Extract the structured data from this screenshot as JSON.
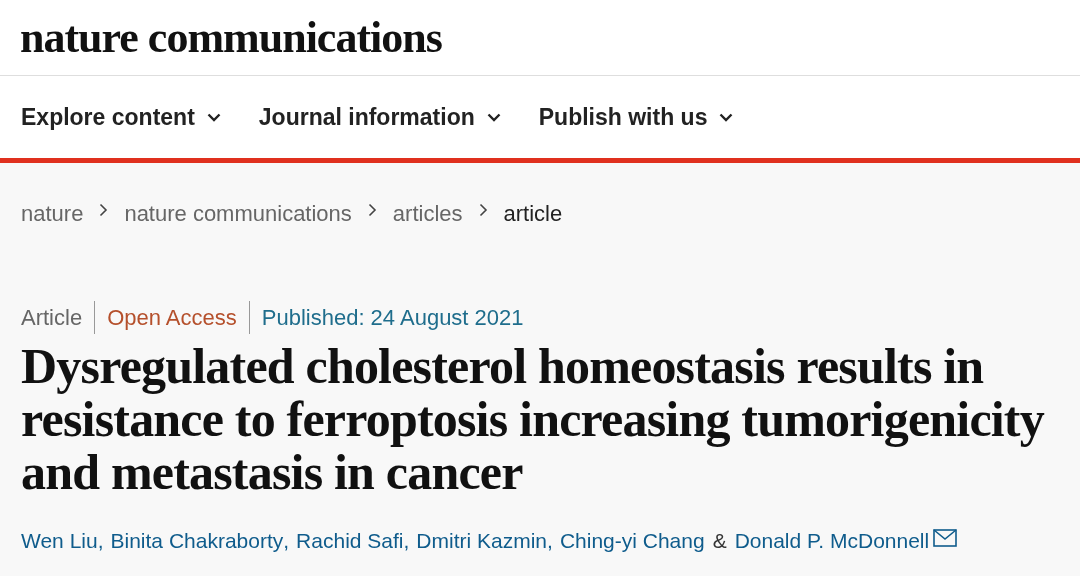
{
  "site": {
    "logo": "nature communications"
  },
  "nav": [
    {
      "label": "Explore content"
    },
    {
      "label": "Journal information"
    },
    {
      "label": "Publish with us"
    }
  ],
  "breadcrumbs": [
    {
      "label": "nature",
      "current": false
    },
    {
      "label": "nature communications",
      "current": false
    },
    {
      "label": "articles",
      "current": false
    },
    {
      "label": "article",
      "current": true
    }
  ],
  "meta": {
    "type": "Article",
    "access": "Open Access",
    "published": "Published: 24 August 2021"
  },
  "title": "Dysregulated cholesterol homeostasis results in resistance to ferroptosis increasing tumorigenicity and metastasis in cancer",
  "authors": [
    {
      "name": "Wen Liu",
      "separator": ","
    },
    {
      "name": "Binita Chakraborty",
      "separator": ","
    },
    {
      "name": "Rachid Safi",
      "separator": ","
    },
    {
      "name": "Dmitri Kazmin",
      "separator": ","
    },
    {
      "name": "Ching-yi Chang",
      "separator": "&"
    },
    {
      "name": "Donald P. McDonnell",
      "corresponding": true
    }
  ]
}
